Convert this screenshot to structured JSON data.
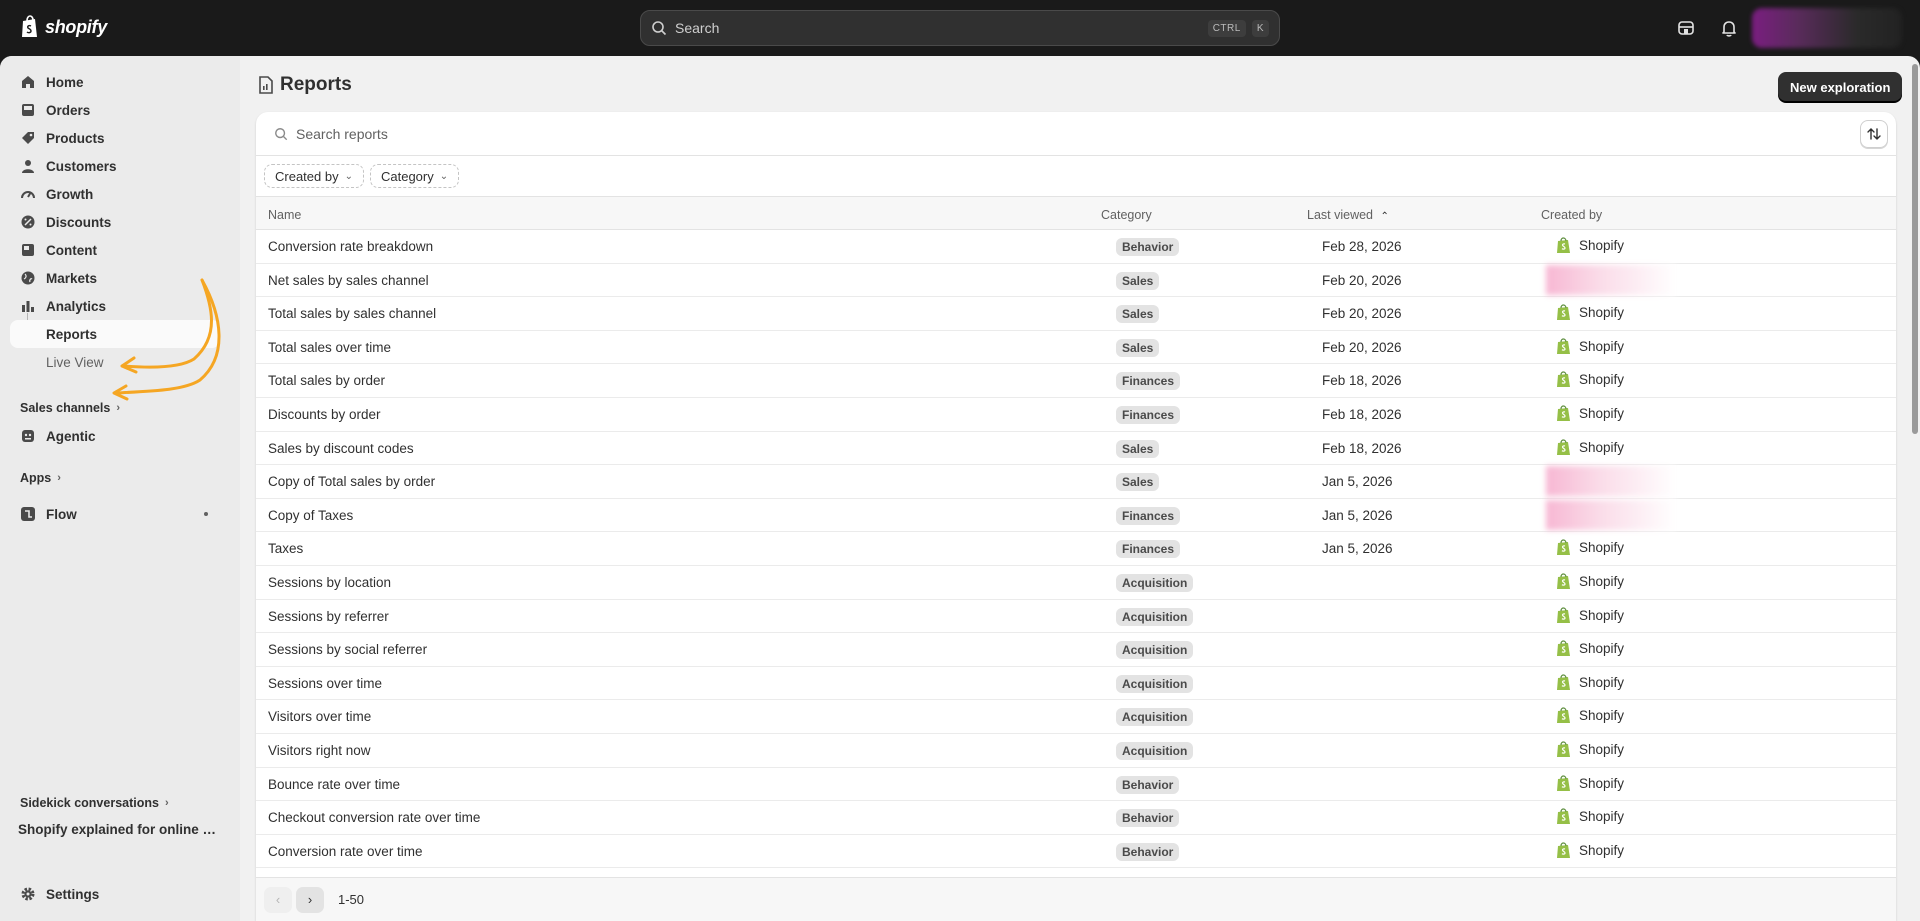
{
  "topbar": {
    "brand": "shopify",
    "search_placeholder": "Search",
    "shortcut_keys": [
      "CTRL",
      "K"
    ],
    "icons": [
      "store-icon",
      "bell-icon"
    ]
  },
  "sidebar": {
    "items": [
      {
        "label": "Home",
        "icon": "home-icon"
      },
      {
        "label": "Orders",
        "icon": "inbox-icon"
      },
      {
        "label": "Products",
        "icon": "tag-icon"
      },
      {
        "label": "Customers",
        "icon": "person-icon"
      },
      {
        "label": "Growth",
        "icon": "gauge-icon"
      },
      {
        "label": "Discounts",
        "icon": "discount-icon"
      },
      {
        "label": "Content",
        "icon": "content-icon"
      },
      {
        "label": "Markets",
        "icon": "globe-icon"
      },
      {
        "label": "Analytics",
        "icon": "bar-chart-icon"
      },
      {
        "label": "Reports",
        "active": true
      },
      {
        "label": "Live View"
      }
    ],
    "sales_channels_label": "Sales channels",
    "agentic_label": "Agentic",
    "apps_label": "Apps",
    "flow_label": "Flow",
    "sidekick_label": "Sidekick conversations",
    "sidekick_conversation": "Shopify explained for online s...",
    "settings_label": "Settings"
  },
  "page": {
    "title": "Reports",
    "new_button": "New exploration",
    "search_placeholder": "Search reports",
    "filters": [
      "Created by",
      "Category"
    ],
    "columns": {
      "name": "Name",
      "category": "Category",
      "last_viewed": "Last viewed",
      "created_by": "Created by"
    }
  },
  "reports": [
    {
      "name": "Conversion rate breakdown",
      "category": "Behavior",
      "last_viewed": "Feb 28, 2026",
      "created_by": "Shopify"
    },
    {
      "name": "Net sales by sales channel",
      "category": "Sales",
      "last_viewed": "Feb 20, 2026",
      "created_by": ""
    },
    {
      "name": "Total sales by sales channel",
      "category": "Sales",
      "last_viewed": "Feb 20, 2026",
      "created_by": "Shopify"
    },
    {
      "name": "Total sales over time",
      "category": "Sales",
      "last_viewed": "Feb 20, 2026",
      "created_by": "Shopify"
    },
    {
      "name": "Total sales by order",
      "category": "Finances",
      "last_viewed": "Feb 18, 2026",
      "created_by": "Shopify"
    },
    {
      "name": "Discounts by order",
      "category": "Finances",
      "last_viewed": "Feb 18, 2026",
      "created_by": "Shopify"
    },
    {
      "name": "Sales by discount codes",
      "category": "Sales",
      "last_viewed": "Feb 18, 2026",
      "created_by": "Shopify"
    },
    {
      "name": "Copy of Total sales by order",
      "category": "Sales",
      "last_viewed": "Jan 5, 2026",
      "created_by": ""
    },
    {
      "name": "Copy of Taxes",
      "category": "Finances",
      "last_viewed": "Jan 5, 2026",
      "created_by": ""
    },
    {
      "name": "Taxes",
      "category": "Finances",
      "last_viewed": "Jan 5, 2026",
      "created_by": "Shopify"
    },
    {
      "name": "Sessions by location",
      "category": "Acquisition",
      "last_viewed": "",
      "created_by": "Shopify"
    },
    {
      "name": "Sessions by referrer",
      "category": "Acquisition",
      "last_viewed": "",
      "created_by": "Shopify"
    },
    {
      "name": "Sessions by social referrer",
      "category": "Acquisition",
      "last_viewed": "",
      "created_by": "Shopify"
    },
    {
      "name": "Sessions over time",
      "category": "Acquisition",
      "last_viewed": "",
      "created_by": "Shopify"
    },
    {
      "name": "Visitors over time",
      "category": "Acquisition",
      "last_viewed": "",
      "created_by": "Shopify"
    },
    {
      "name": "Visitors right now",
      "category": "Acquisition",
      "last_viewed": "",
      "created_by": "Shopify"
    },
    {
      "name": "Bounce rate over time",
      "category": "Behavior",
      "last_viewed": "",
      "created_by": "Shopify"
    },
    {
      "name": "Checkout conversion rate over time",
      "category": "Behavior",
      "last_viewed": "",
      "created_by": "Shopify"
    },
    {
      "name": "Conversion rate over time",
      "category": "Behavior",
      "last_viewed": "",
      "created_by": "Shopify"
    }
  ],
  "pagination": {
    "range": "1-50"
  },
  "colors": {
    "accent": "#303030",
    "annotation_arrow": "#f5a623",
    "shopify_green": "#95bf47"
  }
}
